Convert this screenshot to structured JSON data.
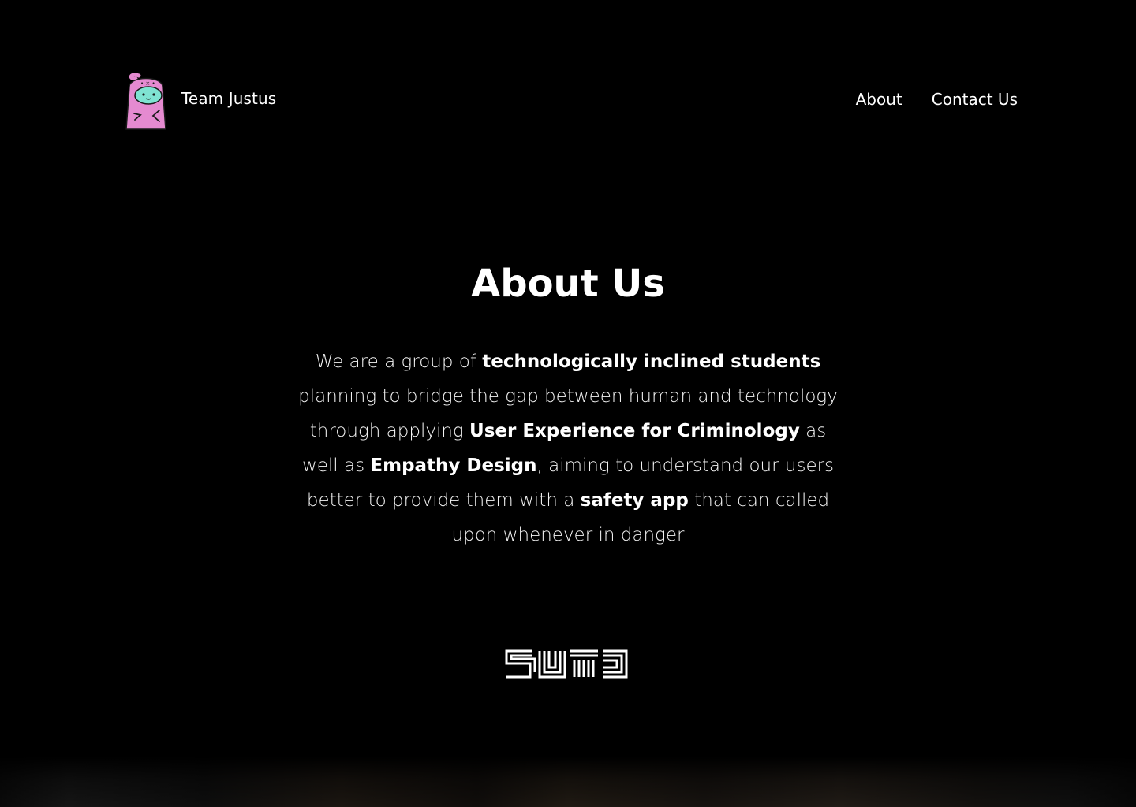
{
  "header": {
    "brand_name": "Team Justus",
    "logo_icon": "pink-ghost-mascot-icon",
    "nav": [
      {
        "label": "About"
      },
      {
        "label": "Contact Us"
      }
    ]
  },
  "main": {
    "title": "About Us",
    "paragraph": [
      {
        "text": "We are a group of ",
        "bold": false
      },
      {
        "text": "technologically inclined students",
        "bold": true
      },
      {
        "text": " planning to bridge the gap between human and technology through applying ",
        "bold": false
      },
      {
        "text": "User Experience for Criminology",
        "bold": true
      },
      {
        "text": " as well as ",
        "bold": false
      },
      {
        "text": "Empathy Design",
        "bold": true
      },
      {
        "text": ", aiming to understand our users better to provide them with a ",
        "bold": false
      },
      {
        "text": "safety app",
        "bold": true
      },
      {
        "text": " that can called upon whenever in danger",
        "bold": false
      }
    ],
    "partner_logo_text": "SUTD",
    "partner_logo_icon": "sutd-maze-logo-icon"
  },
  "colors": {
    "background": "#000000",
    "text": "#ffffff",
    "mascot_pink": "#e58ad0",
    "mascot_face": "#7fe3d2"
  }
}
